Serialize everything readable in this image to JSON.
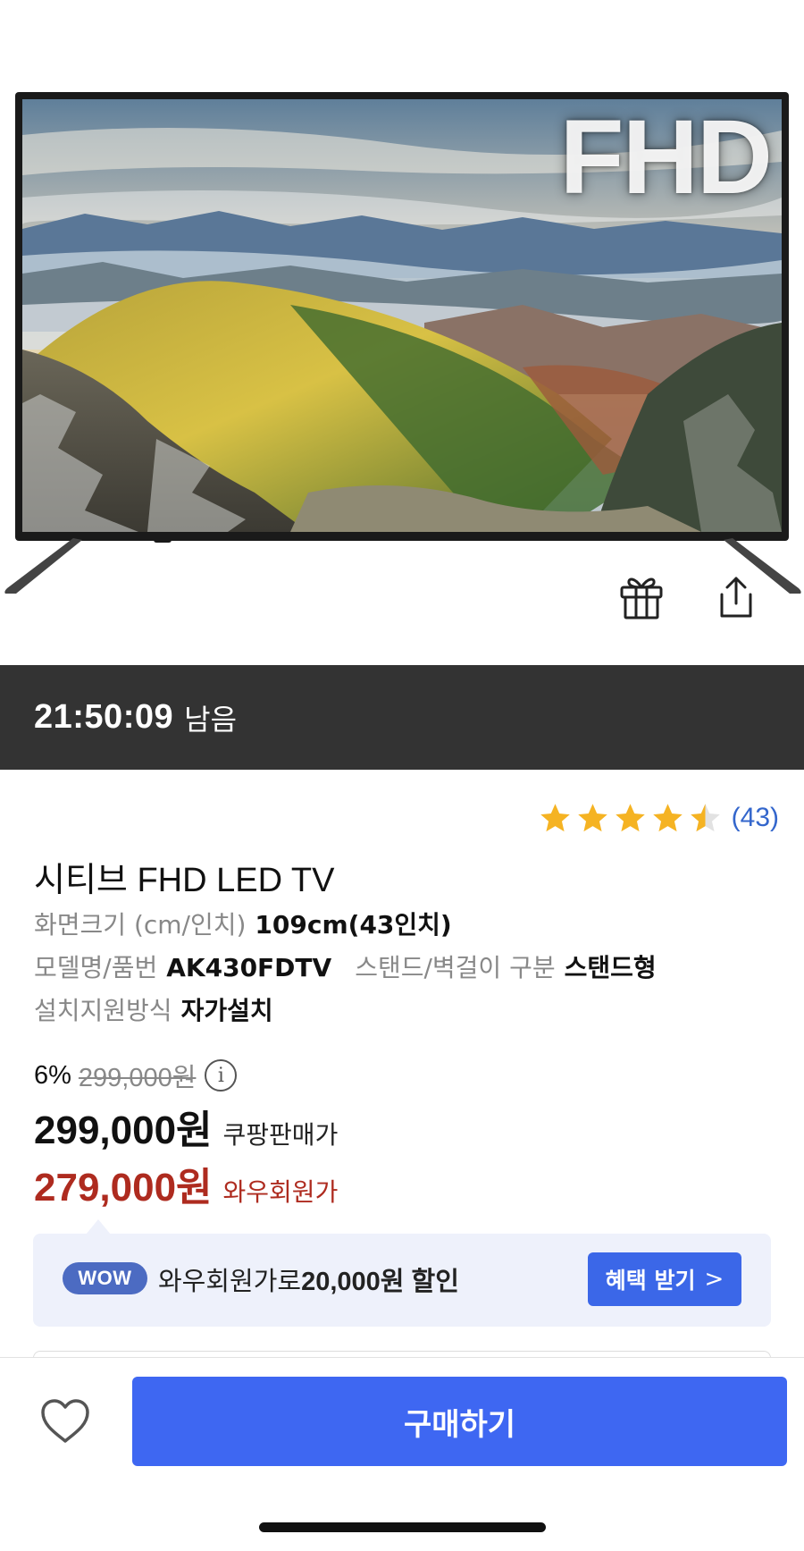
{
  "hero": {
    "overlay_text": "FHD",
    "icons": {
      "gift": "gift-icon",
      "share": "share-icon"
    }
  },
  "timer": {
    "time": "21:50:09",
    "suffix": "남음"
  },
  "rating": {
    "stars": 4.5,
    "count": "(43)",
    "star_color": "#f5b323",
    "count_color": "#3366cc"
  },
  "product": {
    "title": "시티브 FHD LED TV",
    "specs": {
      "screen_size_label": "화면크기 (cm/인치)",
      "screen_size_value": "109cm(43인치)",
      "model_label": "모델명/품번",
      "model_value": "AK430FDTV",
      "stand_label": "스탠드/벽걸이 구분",
      "stand_value": "스탠드형",
      "install_label": "설치지원방식",
      "install_value": "자가설치"
    }
  },
  "pricing": {
    "discount_pct": "6%",
    "original_price": "299,000원",
    "info_icon": "i",
    "coupang_price": "299,000원",
    "coupang_label": "쿠팡판매가",
    "wow_price": "279,000원",
    "wow_label": "와우회원가",
    "accent_red": "#ae2b1f"
  },
  "wow_promo": {
    "badge": "WOW",
    "text_prefix": "와우회원가로",
    "text_amount": "20,000원 할인",
    "button_label": "혜택 받기",
    "button_chevron": ">"
  },
  "bottom": {
    "buy_label": "구매하기",
    "buy_color": "#3e67f2",
    "heart_icon": "heart-icon"
  }
}
